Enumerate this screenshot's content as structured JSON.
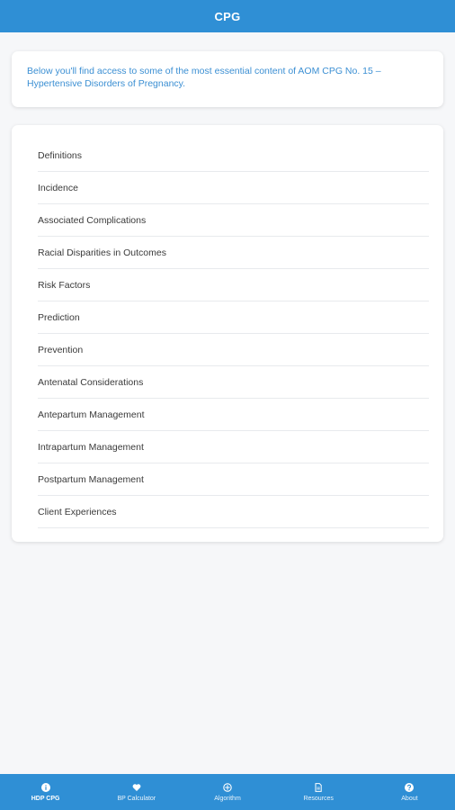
{
  "header": {
    "title": "CPG"
  },
  "intro": {
    "text": "Below you'll find access to some of the most essential content of AOM CPG No. 15 – Hypertensive Disorders of Pregnancy."
  },
  "menu": {
    "items": [
      {
        "label": "Definitions"
      },
      {
        "label": "Incidence"
      },
      {
        "label": "Associated Complications"
      },
      {
        "label": "Racial Disparities in Outcomes"
      },
      {
        "label": "Risk Factors"
      },
      {
        "label": "Prediction"
      },
      {
        "label": "Prevention"
      },
      {
        "label": "Antenatal Considerations"
      },
      {
        "label": "Antepartum Management"
      },
      {
        "label": "Intrapartum Management"
      },
      {
        "label": "Postpartum Management"
      },
      {
        "label": "Client Experiences"
      }
    ]
  },
  "tabbar": {
    "tabs": [
      {
        "label": "HDP CPG",
        "icon": "info-circle-icon",
        "active": true
      },
      {
        "label": "BP Calculator",
        "icon": "heart-icon",
        "active": false
      },
      {
        "label": "Algorithm",
        "icon": "compass-icon",
        "active": false
      },
      {
        "label": "Resources",
        "icon": "document-icon",
        "active": false
      },
      {
        "label": "About",
        "icon": "question-circle-icon",
        "active": false
      }
    ]
  },
  "colors": {
    "brand_blue": "#2f8fd5",
    "intro_text": "#3b8fd3",
    "background": "#f6f7f9"
  }
}
